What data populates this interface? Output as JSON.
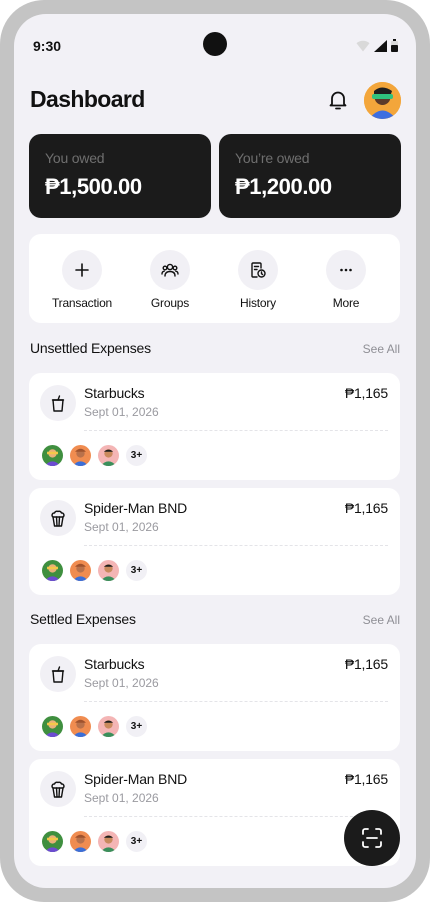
{
  "status_bar": {
    "time": "9:30"
  },
  "header": {
    "title": "Dashboard"
  },
  "balances": [
    {
      "label": "You owed",
      "amount": "₱1,500.00"
    },
    {
      "label": "You’re owed",
      "amount": "₱1,200.00"
    }
  ],
  "actions": [
    {
      "label": "Transaction",
      "icon": "plus-icon"
    },
    {
      "label": "Groups",
      "icon": "users-icon"
    },
    {
      "label": "History",
      "icon": "history-icon"
    },
    {
      "label": "More",
      "icon": "more-dots-icon"
    }
  ],
  "unsettled": {
    "title": "Unsettled Expenses",
    "see_all": "See All",
    "items": [
      {
        "name": "Starbucks",
        "date": "Sept 01, 2026",
        "amount": "₱1,165",
        "icon": "cup-icon",
        "more": "3+"
      },
      {
        "name": "Spider-Man BND",
        "date": "Sept 01, 2026",
        "amount": "₱1,165",
        "icon": "popcorn-icon",
        "more": "3+"
      }
    ]
  },
  "settled": {
    "title": "Settled Expenses",
    "see_all": "See All",
    "items": [
      {
        "name": "Starbucks",
        "date": "Sept 01, 2026",
        "amount": "₱1,165",
        "icon": "cup-icon",
        "more": "3+"
      },
      {
        "name": "Spider-Man BND",
        "date": "Sept 01, 2026",
        "amount": "₱1,165",
        "icon": "popcorn-icon",
        "more": "3+"
      }
    ]
  },
  "fab": {
    "icon": "scan-icon"
  },
  "colors": {
    "card_dark": "#1b1b1b",
    "background": "#f2f1f6",
    "muted": "#9a9aa0"
  }
}
